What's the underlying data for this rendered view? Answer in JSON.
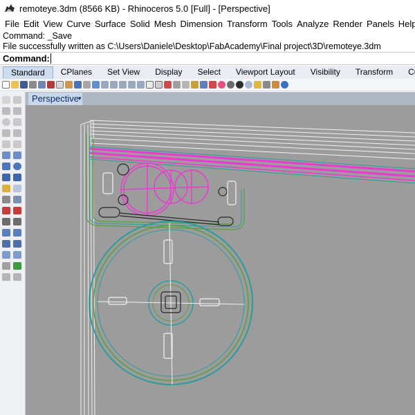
{
  "window": {
    "title": "remoteye.3dm (8566 KB) - Rhinoceros 5.0 [Full] - [Perspective]"
  },
  "menu": [
    "File",
    "Edit",
    "View",
    "Curve",
    "Surface",
    "Solid",
    "Mesh",
    "Dimension",
    "Transform",
    "Tools",
    "Analyze",
    "Render",
    "Panels",
    "Help"
  ],
  "command_history": [
    "Command: _Save",
    "File successfully written as C:\\Users\\Daniele\\Desktop\\FabAcademy\\Final project\\3D\\remoteye.3dm"
  ],
  "command_prompt": {
    "label": "Command:",
    "value": ""
  },
  "toolbar_tabs": [
    "Standard",
    "CPlanes",
    "Set View",
    "Display",
    "Select",
    "Viewport Layout",
    "Visibility",
    "Transform",
    "Curve To"
  ],
  "active_tab_index": 0,
  "viewport": {
    "label": "Perspective",
    "menu_arrow": "▾"
  },
  "colors": {
    "viewport_bg": "#9c9c9c",
    "wire_white": "#f2f2f2",
    "wire_teal": "#2a9c9c",
    "wire_green": "#55a13e",
    "wire_magenta": "#e93ad3",
    "wire_dark": "#262626"
  }
}
